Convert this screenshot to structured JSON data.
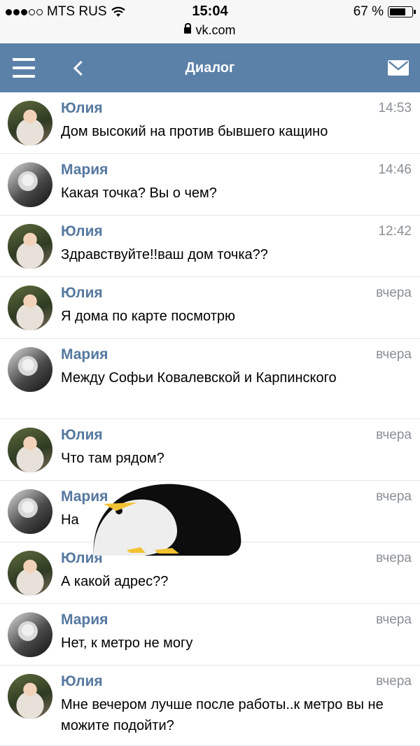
{
  "status_bar": {
    "carrier": "MTS RUS",
    "time": "15:04",
    "url": "vk.com",
    "battery": "67 %",
    "battery_level": 0.67
  },
  "header": {
    "title": "Диалог",
    "icons": [
      "menu-icon",
      "back-arrow-icon",
      "mail-icon"
    ]
  },
  "colors": {
    "header_bg": "#5b81a8",
    "name": "#55789f",
    "time": "#8a8f96"
  },
  "messages": [
    {
      "name": "Юлия",
      "time": "14:53",
      "text": "Дом высокий на против бывшего кащино"
    },
    {
      "name": "Мария",
      "time": "14:46",
      "text": "Какая точка? Вы о чем?"
    },
    {
      "name": "Юлия",
      "time": "12:42",
      "text": "Здравствуйте!!ваш дом точка??"
    },
    {
      "name": "Юлия",
      "time": "вчера",
      "text": "Я дома по карте посмотрю"
    },
    {
      "name": "Мария",
      "time": "вчера",
      "text": "Между Софьи Ковалевской и Карпинского"
    },
    {
      "name": "Юлия",
      "time": "вчера",
      "text": "Что там рядом?"
    },
    {
      "name": "Мария",
      "time": "вчера",
      "text": "На"
    },
    {
      "name": "Юлия",
      "time": "вчера",
      "text": "А какой адрес??"
    },
    {
      "name": "Мария",
      "time": "вчера",
      "text": "Нет, к метро не могу"
    },
    {
      "name": "Юлия",
      "time": "вчера",
      "text": "Мне вечером лучше после работы..к метро вы не можите подойти?"
    }
  ]
}
